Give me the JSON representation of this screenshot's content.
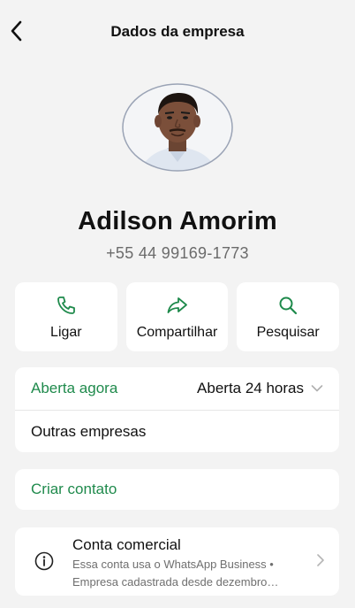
{
  "header": {
    "title": "Dados da empresa"
  },
  "profile": {
    "name": "Adilson Amorim",
    "phone": "+55 44 99169-1773"
  },
  "actions": [
    {
      "label": "Ligar",
      "icon": "phone-icon"
    },
    {
      "label": "Compartilhar",
      "icon": "share-icon"
    },
    {
      "label": "Pesquisar",
      "icon": "search-icon"
    }
  ],
  "hours": {
    "status": "Aberta agora",
    "schedule": "Aberta 24 horas",
    "other": "Outras empresas"
  },
  "create_contact": {
    "label": "Criar contato"
  },
  "business": {
    "title": "Conta comercial",
    "line1": "Essa conta usa o WhatsApp Business •",
    "line2": "Empresa cadastrada desde dezembro…"
  },
  "colors": {
    "accent": "#1f8a4c",
    "background": "#f3f3f3",
    "card": "#ffffff",
    "muted": "#6f6f6f"
  }
}
